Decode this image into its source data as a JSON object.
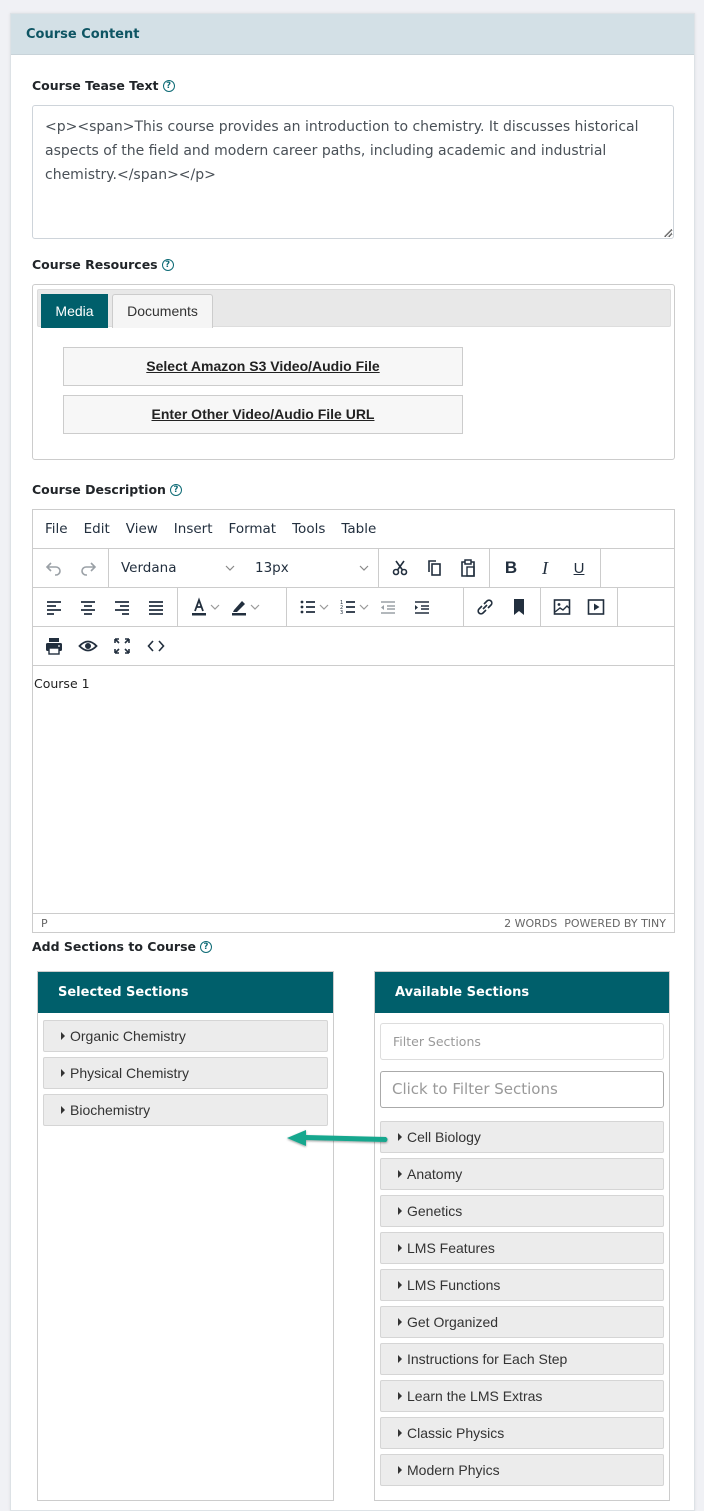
{
  "card": {
    "title": "Course Content"
  },
  "tease": {
    "label": "Course Tease Text",
    "value": "<p><span>This course provides an introduction to chemistry. It discusses historical aspects of the field and modern career paths, including academic and industrial chemistry.</span></p>"
  },
  "resources": {
    "label": "Course Resources",
    "tabs": [
      {
        "label": "Media",
        "active": true
      },
      {
        "label": "Documents",
        "active": false
      }
    ],
    "buttons": [
      "Select Amazon S3 Video/Audio File",
      "Enter Other Video/Audio File URL"
    ]
  },
  "description": {
    "label": "Course Description",
    "menu": [
      "File",
      "Edit",
      "View",
      "Insert",
      "Format",
      "Tools",
      "Table"
    ],
    "font_family": "Verdana",
    "font_size": "13px",
    "content": "Course 1",
    "status_path": "P",
    "word_count": "2 WORDS",
    "powered_by": "POWERED BY TINY"
  },
  "sections": {
    "label": "Add Sections to Course",
    "selected_title": "Selected Sections",
    "available_title": "Available Sections",
    "selected": [
      "Organic Chemistry",
      "Physical Chemistry",
      "Biochemistry"
    ],
    "filter_placeholder": "Filter Sections",
    "filter_click_placeholder": "Click to Filter Sections",
    "available": [
      "Cell Biology",
      "Anatomy",
      "Genetics",
      "LMS Features",
      "LMS Functions",
      "Get Organized",
      "Instructions for Each Step",
      "Learn the LMS Extras",
      "Classic Physics",
      "Modern Phyics"
    ]
  },
  "colors": {
    "accent": "#005f6b",
    "header_bg": "#d3e0e6",
    "arrow": "#17a78e"
  }
}
